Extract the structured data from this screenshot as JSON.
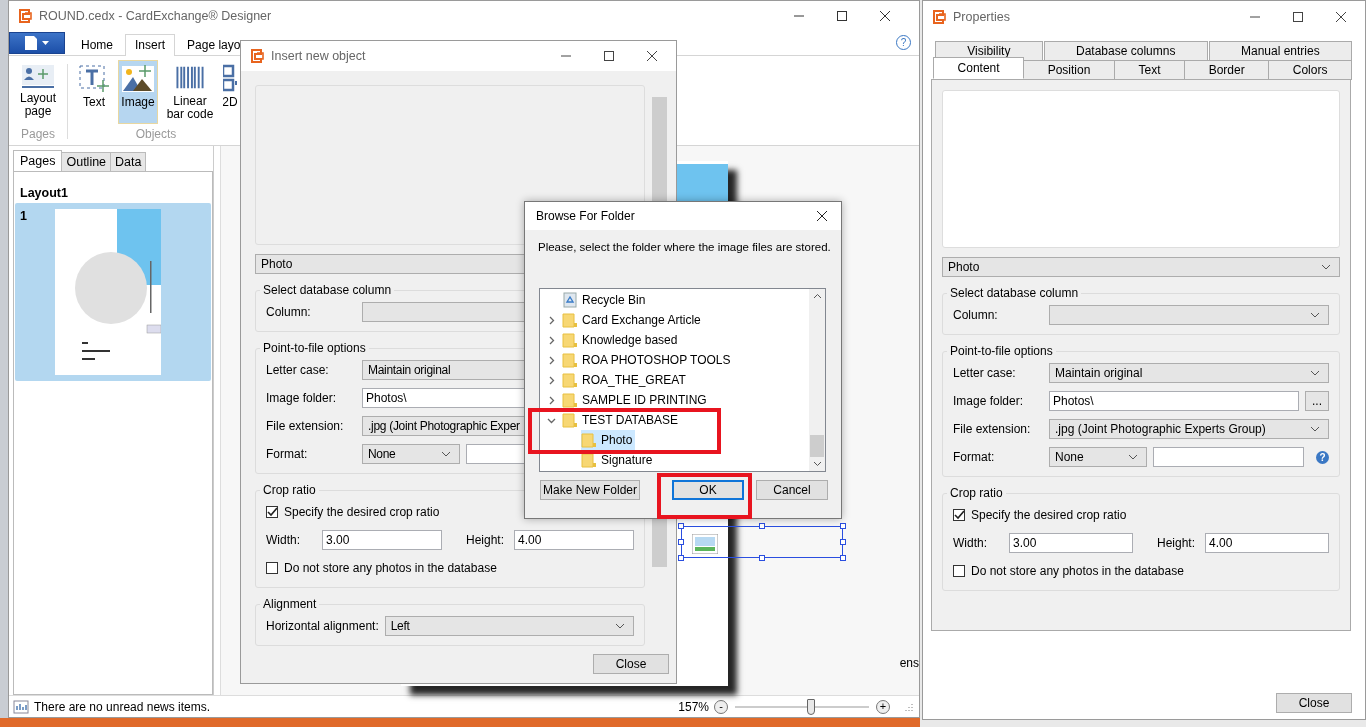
{
  "main_window": {
    "title": "ROUND.cedx - CardExchange® Designer",
    "help": "?",
    "ribbon_tabs": [
      {
        "label": "Home",
        "selected": false
      },
      {
        "label": "Insert",
        "selected": true
      },
      {
        "label": "Page layo",
        "selected": false
      }
    ],
    "ribbon_groups": [
      {
        "label": "Pages",
        "buttons": [
          {
            "label": "Layout page",
            "kind": "layout",
            "selected": false
          }
        ]
      },
      {
        "label": "Objects",
        "buttons": [
          {
            "label": "Text",
            "kind": "text",
            "selected": false
          },
          {
            "label": "Image",
            "kind": "image",
            "selected": true
          },
          {
            "label": "Linear bar code",
            "kind": "barcode",
            "selected": false
          },
          {
            "label": "2D",
            "kind": "qr",
            "selected": false
          }
        ]
      }
    ],
    "panel_tabs": [
      {
        "label": "Pages",
        "selected": true
      },
      {
        "label": "Outline",
        "selected": false
      },
      {
        "label": "Data",
        "selected": false
      }
    ],
    "layout_name": "Layout1",
    "pages": [
      {
        "number": "1",
        "selected": true
      }
    ],
    "canvas_text": "ens",
    "status_text": "There are no unread news items.",
    "zoom": {
      "reading": "157%",
      "minus": "-",
      "plus": "+",
      "level": 0.57
    }
  },
  "insert_dialog": {
    "title": "Insert new object",
    "source": "Photo",
    "groups": [
      {
        "title": "Select database column",
        "rows": [
          {
            "kind": "combo",
            "label": "Column:"
          }
        ]
      },
      {
        "title": "Point-to-file options",
        "rows": [
          {
            "kind": "combo",
            "label": "Letter case:",
            "value": "Maintain original"
          },
          {
            "kind": "field",
            "label": "Image folder:",
            "value": "Photos\\"
          },
          {
            "kind": "combo",
            "label": "File extension:",
            "value": ".jpg (Joint Photographic Exper"
          },
          {
            "kind": "combo_field",
            "label": "Format:",
            "value": "None"
          }
        ]
      },
      {
        "title": "Crop ratio",
        "rows": [
          {
            "kind": "check",
            "label": "Specify the desired crop ratio",
            "checked": true
          },
          {
            "kind": "pair",
            "label": "Width:",
            "value": "3.00",
            "label2": "Height:",
            "value2": "4.00"
          },
          {
            "kind": "check",
            "label": "Do not store any photos in the database",
            "checked": false
          }
        ]
      },
      {
        "title": "Alignment",
        "rows": [
          {
            "kind": "combo",
            "label": "Horizontal alignment:",
            "value": "Left"
          }
        ]
      }
    ],
    "close": "Close"
  },
  "browse_dialog": {
    "title": "Browse For Folder",
    "message": "Please, select the folder where the image files are stored.",
    "tree": [
      {
        "label": "Recycle Bin",
        "kind": "recycle",
        "selected": false
      },
      {
        "label": "Card Exchange Article",
        "kind": "folder",
        "expanded": false,
        "selected": false
      },
      {
        "label": "Knowledge based",
        "kind": "folder",
        "expanded": false,
        "selected": false
      },
      {
        "label": "ROA PHOTOSHOP TOOLS",
        "kind": "folder",
        "expanded": false,
        "selected": false
      },
      {
        "label": "ROA_THE_GREAT",
        "kind": "folder",
        "expanded": false,
        "selected": false
      },
      {
        "label": "SAMPLE ID PRINTING",
        "kind": "folder",
        "expanded": false,
        "selected": false
      },
      {
        "label": "TEST DATABASE",
        "kind": "folder",
        "expanded": true,
        "selected": false,
        "children": [
          {
            "label": "Photo",
            "kind": "folder",
            "selected": true
          },
          {
            "label": "Signature",
            "kind": "folder",
            "selected": false
          }
        ]
      }
    ],
    "buttons": [
      {
        "label": "Make New Folder",
        "kind": "normal"
      },
      {
        "label": "OK",
        "kind": "default"
      },
      {
        "label": "Cancel",
        "kind": "normal"
      }
    ]
  },
  "properties": {
    "title": "Properties",
    "tab_rows": [
      [
        {
          "label": "Visibility",
          "selected": false
        },
        {
          "label": "Database columns",
          "selected": false
        },
        {
          "label": "Manual entries",
          "selected": false
        }
      ],
      [
        {
          "label": "Content",
          "selected": true
        },
        {
          "label": "Position",
          "selected": false
        },
        {
          "label": "Text",
          "selected": false
        },
        {
          "label": "Border",
          "selected": false
        },
        {
          "label": "Colors",
          "selected": false
        }
      ]
    ],
    "source": "Photo",
    "groups": [
      {
        "title": "Select database column",
        "rows": [
          {
            "kind": "combo",
            "label": "Column:"
          }
        ]
      },
      {
        "title": "Point-to-file options",
        "rows": [
          {
            "kind": "combo",
            "label": "Letter case:",
            "value": "Maintain original"
          },
          {
            "kind": "field",
            "label": "Image folder:",
            "value": "Photos\\",
            "button": "..."
          },
          {
            "kind": "combo",
            "label": "File extension:",
            "value": ".jpg (Joint Photographic Experts Group)"
          },
          {
            "kind": "combo_field",
            "label": "Format:",
            "value": "None",
            "help": "?"
          }
        ]
      },
      {
        "title": "Crop ratio",
        "rows": [
          {
            "kind": "check",
            "label": "Specify the desired crop ratio",
            "checked": true
          },
          {
            "kind": "pair",
            "label": "Width:",
            "value": "3.00",
            "label2": "Height:",
            "value2": "4.00"
          },
          {
            "kind": "check",
            "label": "Do not store any photos in the database",
            "checked": false
          }
        ]
      }
    ],
    "close": "Close"
  }
}
